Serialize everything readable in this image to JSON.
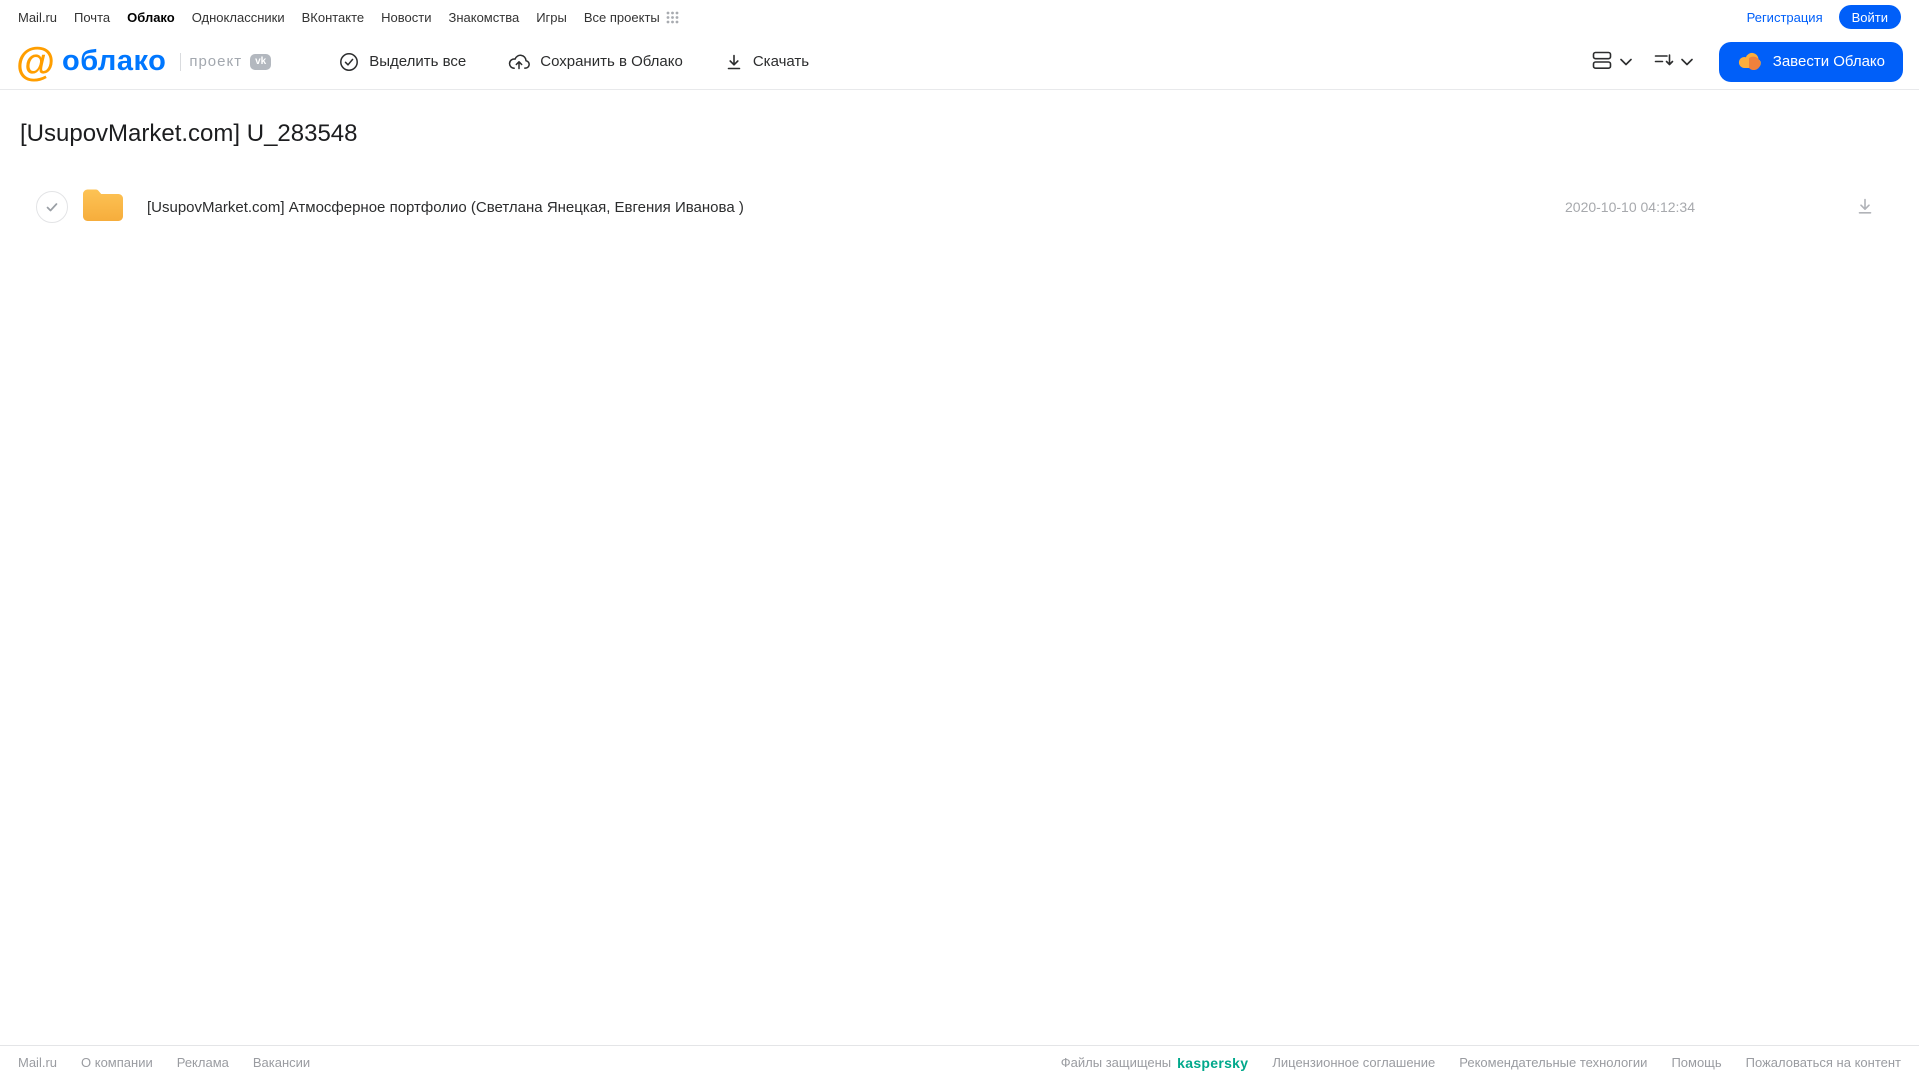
{
  "colors": {
    "brand_blue": "#005ff9",
    "logo_blue": "#0077ff",
    "logo_orange": "#ff9e00",
    "folder_yellow": "#f9b64a",
    "kaspersky_green": "#00a88b"
  },
  "top_nav": {
    "items": [
      "Mail.ru",
      "Почта",
      "Облако",
      "Одноклассники",
      "ВКонтакте",
      "Новости",
      "Знакомства",
      "Игры",
      "Все проекты"
    ],
    "registration": "Регистрация",
    "login": "Войти"
  },
  "header": {
    "logo_at": "@",
    "logo_text": "облако",
    "project_label": "проект",
    "vk_badge": "vk",
    "toolbar": {
      "select_all": "Выделить все",
      "save_to_cloud": "Сохранить в Облако",
      "download": "Скачать"
    },
    "cta": "Завести Облако"
  },
  "page": {
    "title": "[UsupovMarket.com] U_283548"
  },
  "file_list": {
    "rows": [
      {
        "name": "[UsupovMarket.com] Атмосферное портфолио (Светлана Янецкая, Евгения Иванова )",
        "date": "2020-10-10 04:12:34"
      }
    ]
  },
  "footer": {
    "left": [
      "Mail.ru",
      "О компании",
      "Реклама",
      "Вакансии"
    ],
    "protected_label": "Файлы защищены",
    "kaspersky": "kaspersky",
    "right": [
      "Лицензионное соглашение",
      "Рекомендательные технологии",
      "Помощь",
      "Пожаловаться на контент"
    ]
  }
}
